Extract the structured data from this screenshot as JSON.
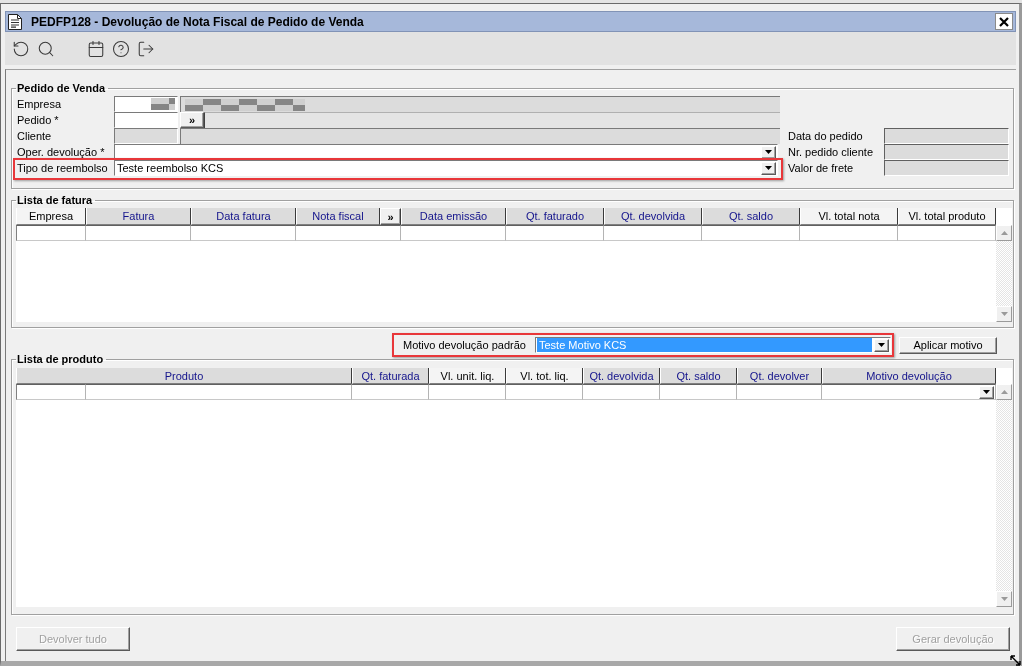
{
  "window": {
    "title": "PEDFP128 - Devolução de Nota Fiscal de Pedido de Venda"
  },
  "pedido_de_venda": {
    "title": "Pedido de Venda",
    "fields": [
      {
        "label": "Empresa",
        "kind": "lookup",
        "code_enabled": true,
        "pixelated": true
      },
      {
        "label": "Pedido *",
        "kind": "search",
        "code_enabled": true,
        "button": "»"
      },
      {
        "label": "Cliente",
        "kind": "lookup",
        "code_enabled": false,
        "pixelated": false
      },
      {
        "label": "Oper. devolução *",
        "kind": "combo",
        "highlighted": false
      },
      {
        "label": "Tipo de reembolso",
        "kind": "combo",
        "value": "Teste reembolso KCS",
        "highlighted": true
      }
    ],
    "side_fields": [
      {
        "label": "Data do pedido"
      },
      {
        "label": "Nr. pedido cliente"
      },
      {
        "label": "Valor de frete"
      }
    ]
  },
  "lista_de_fatura": {
    "title": "Lista de fatura",
    "columns": [
      {
        "label": "Empresa",
        "kind": "text",
        "highlighted": false
      },
      {
        "label": "Fatura",
        "kind": "text",
        "highlighted": true
      },
      {
        "label": "Data fatura",
        "kind": "text",
        "highlighted": true
      },
      {
        "label": "Nota fiscal",
        "kind": "text",
        "highlighted": true
      },
      {
        "label": "»",
        "kind": "button"
      },
      {
        "label": "Data emissão",
        "kind": "text",
        "highlighted": true
      },
      {
        "label": "Qt. faturado",
        "kind": "text",
        "highlighted": true
      },
      {
        "label": "Qt. devolvida",
        "kind": "text",
        "highlighted": true
      },
      {
        "label": "Qt. saldo",
        "kind": "text",
        "highlighted": true
      },
      {
        "label": "Vl. total nota",
        "kind": "text",
        "highlighted": false
      },
      {
        "label": "Vl. total produto",
        "kind": "text",
        "highlighted": false
      }
    ]
  },
  "motivo_padrao": {
    "label": "Motivo devolução padrão",
    "value": "Teste Motivo KCS",
    "selected": true,
    "highlighted": true,
    "button": "Aplicar motivo"
  },
  "lista_de_produto": {
    "title": "Lista de produto",
    "columns": [
      {
        "label": "Produto",
        "kind": "text",
        "highlighted": true
      },
      {
        "label": "Qt. faturada",
        "kind": "text",
        "highlighted": true
      },
      {
        "label": "Vl. unit. liq.",
        "kind": "text",
        "highlighted": false
      },
      {
        "label": "Vl. tot. liq.",
        "kind": "text",
        "highlighted": false
      },
      {
        "label": "Qt. devolvida",
        "kind": "text",
        "highlighted": true
      },
      {
        "label": "Qt. saldo",
        "kind": "text",
        "highlighted": true
      },
      {
        "label": "Qt. devolver",
        "kind": "text",
        "highlighted": true
      },
      {
        "label": "Motivo devolução",
        "kind": "combo",
        "highlighted": true
      }
    ]
  },
  "actions": [
    {
      "label": "Devolver tudo",
      "disabled": true
    },
    {
      "label": "Gerar devolução",
      "disabled": true
    }
  ]
}
